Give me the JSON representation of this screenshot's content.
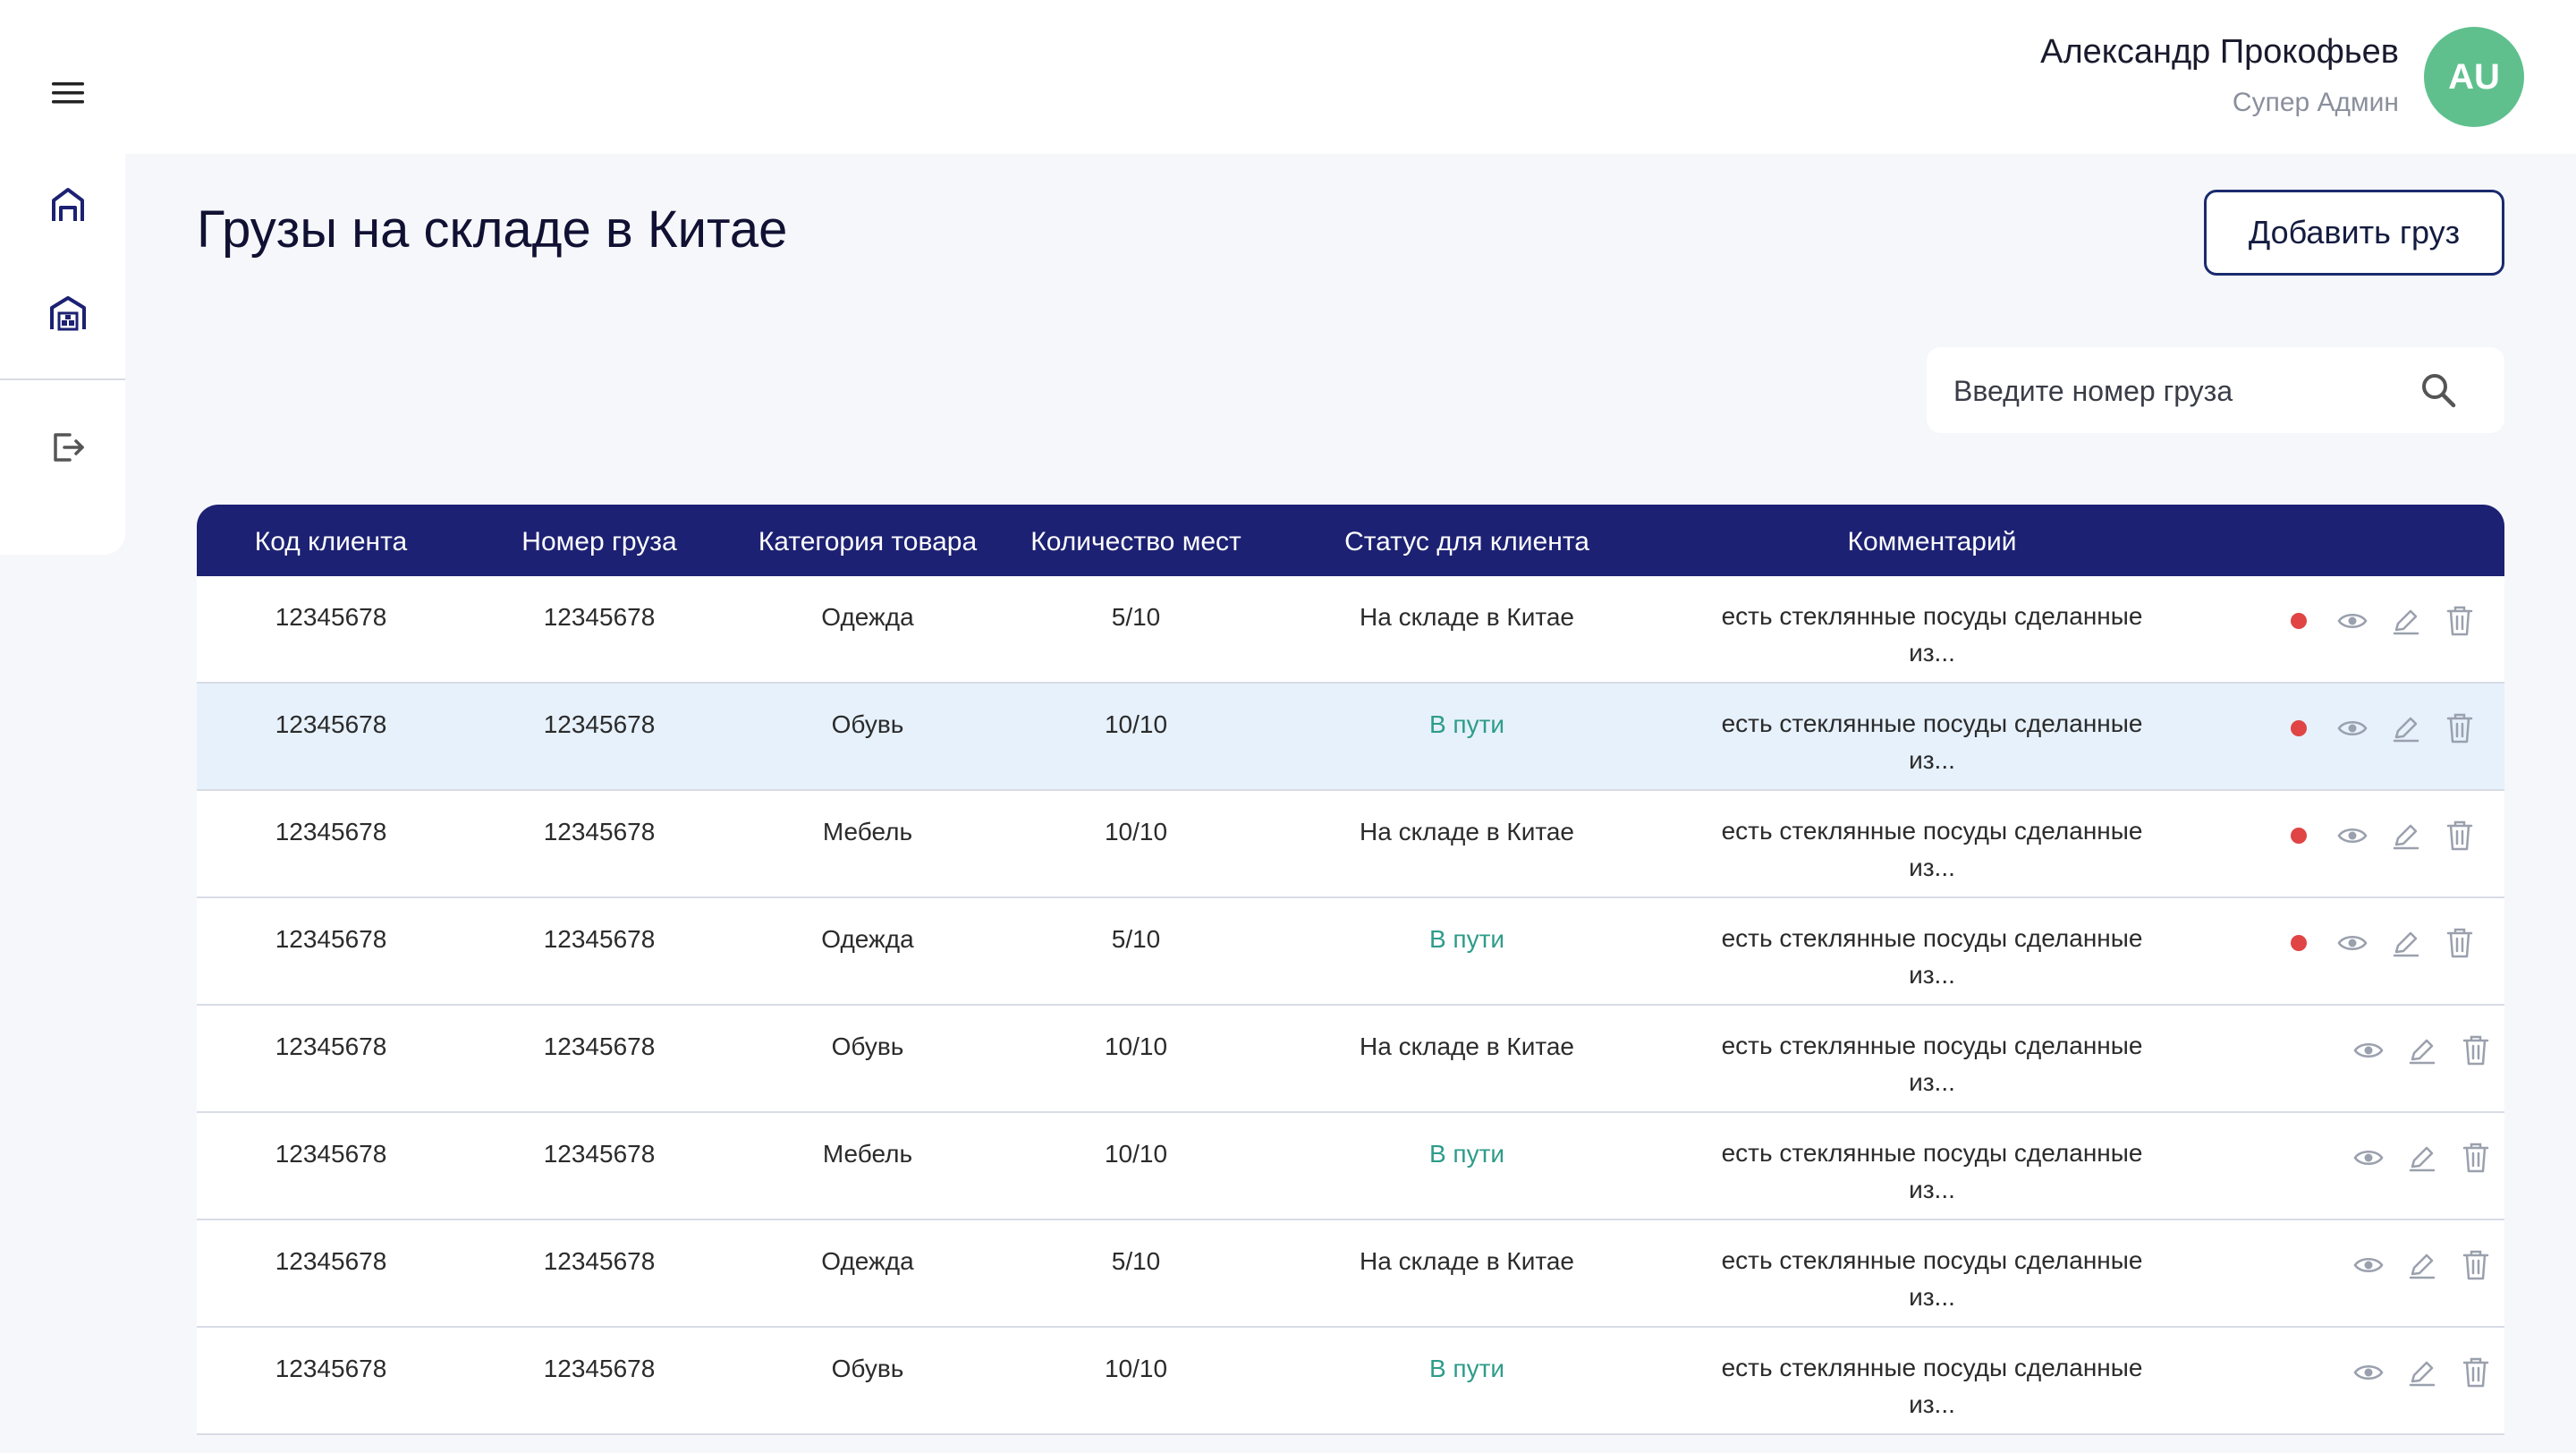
{
  "header": {
    "user_name": "Александр Прокофьев",
    "user_role": "Супер Админ",
    "avatar_initials": "AU",
    "avatar_color": "#5fc08e"
  },
  "sidebar": {
    "items": [
      {
        "name": "menu-icon"
      },
      {
        "name": "home-icon"
      },
      {
        "name": "warehouse-icon"
      },
      {
        "name": "logout-icon"
      }
    ]
  },
  "page": {
    "title": "Грузы на складе в Китае",
    "add_button_label": "Добавить груз",
    "search_placeholder": "Введите номер груза"
  },
  "table": {
    "columns": [
      "Код клиента",
      "Номер груза",
      "Категория товара",
      "Количество мест",
      "Статус для клиента",
      "Комментарий"
    ],
    "rows": [
      {
        "client": "12345678",
        "number": "12345678",
        "category": "Одежда",
        "places": "5/10",
        "status": "На складе в Китае",
        "transit": false,
        "comment1": "есть стеклянные посуды сделанные",
        "comment2": "из...",
        "dot": true,
        "highlight": false
      },
      {
        "client": "12345678",
        "number": "12345678",
        "category": "Обувь",
        "places": "10/10",
        "status": "В пути",
        "transit": true,
        "comment1": "есть стеклянные посуды сделанные",
        "comment2": "из...",
        "dot": true,
        "highlight": true
      },
      {
        "client": "12345678",
        "number": "12345678",
        "category": "Мебель",
        "places": "10/10",
        "status": "На складе в Китае",
        "transit": false,
        "comment1": "есть стеклянные посуды сделанные",
        "comment2": "из...",
        "dot": true,
        "highlight": false
      },
      {
        "client": "12345678",
        "number": "12345678",
        "category": "Одежда",
        "places": "5/10",
        "status": "В пути",
        "transit": true,
        "comment1": "есть стеклянные посуды сделанные",
        "comment2": "из...",
        "dot": true,
        "highlight": false
      },
      {
        "client": "12345678",
        "number": "12345678",
        "category": "Обувь",
        "places": "10/10",
        "status": "На складе в Китае",
        "transit": false,
        "comment1": "есть стеклянные посуды сделанные",
        "comment2": "из...",
        "dot": false,
        "highlight": false
      },
      {
        "client": "12345678",
        "number": "12345678",
        "category": "Мебель",
        "places": "10/10",
        "status": "В пути",
        "transit": true,
        "comment1": "есть стеклянные посуды сделанные",
        "comment2": "из...",
        "dot": false,
        "highlight": false
      },
      {
        "client": "12345678",
        "number": "12345678",
        "category": "Одежда",
        "places": "5/10",
        "status": "На складе в Китае",
        "transit": false,
        "comment1": "есть стеклянные посуды сделанные",
        "comment2": "из...",
        "dot": false,
        "highlight": false
      },
      {
        "client": "12345678",
        "number": "12345678",
        "category": "Обувь",
        "places": "10/10",
        "status": "В пути",
        "transit": true,
        "comment1": "есть стеклянные посуды сделанные",
        "comment2": "из...",
        "dot": false,
        "highlight": false
      }
    ]
  },
  "colors": {
    "header_bg": "#1c2173",
    "transit_text": "#2e9c8a",
    "dot_red": "#e04444",
    "highlight_row": "#e6f1fb"
  }
}
